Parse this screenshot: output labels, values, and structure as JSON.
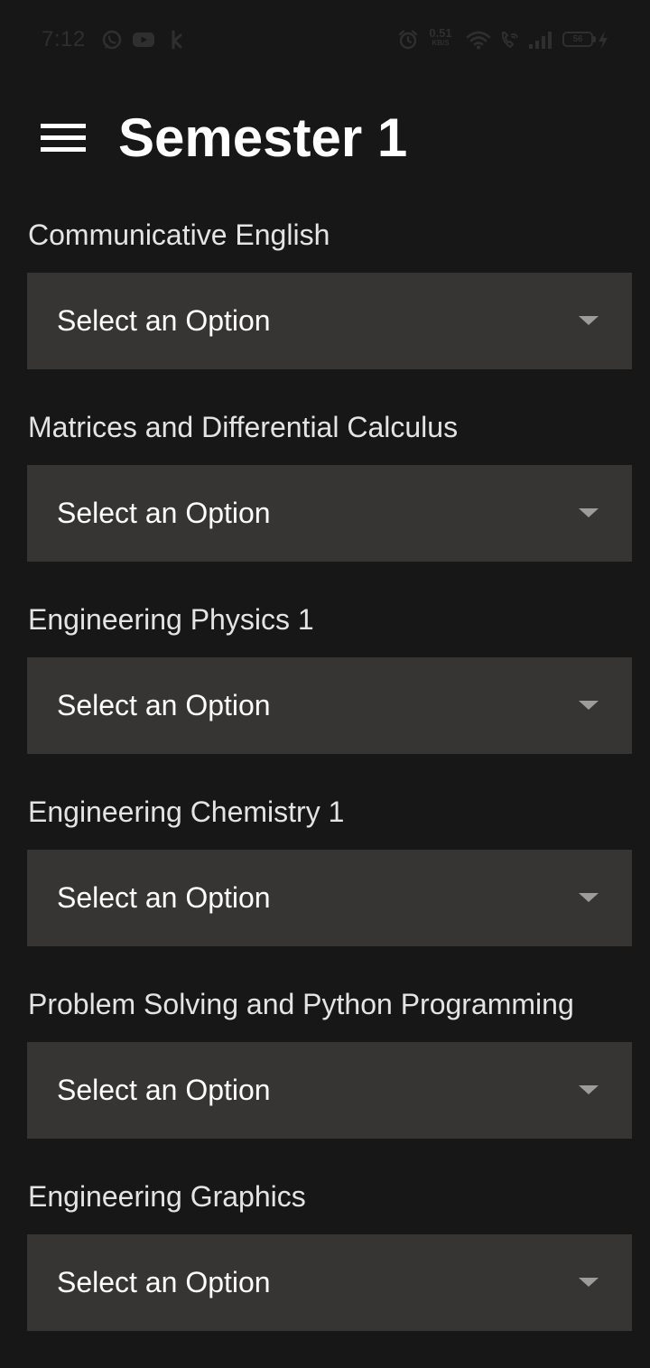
{
  "status_bar": {
    "time": "7:12",
    "net_speed_value": "0.51",
    "net_speed_unit": "KB/S",
    "battery_level": "56",
    "icons": [
      "whatsapp-icon",
      "youtube-icon",
      "app-notification-icon",
      "alarm-icon",
      "wifi-icon",
      "wifi-calling-icon",
      "signal-icon",
      "battery-icon",
      "charging-icon"
    ]
  },
  "header": {
    "title": "Semester 1",
    "menu_icon": "hamburger-menu-icon"
  },
  "subjects": [
    {
      "label": "Communicative English",
      "selected": "Select an Option"
    },
    {
      "label": "Matrices and Differential Calculus",
      "selected": "Select an Option"
    },
    {
      "label": "Engineering Physics 1",
      "selected": "Select an Option"
    },
    {
      "label": "Engineering Chemistry 1",
      "selected": "Select an Option"
    },
    {
      "label": "Problem Solving and Python Programming",
      "selected": "Select an Option"
    },
    {
      "label": "Engineering Graphics",
      "selected": "Select an Option"
    }
  ],
  "colors": {
    "background": "#171717",
    "dropdown_background": "#373434",
    "title_text": "#ffffff",
    "label_text": "#e4e4e4",
    "caret": "#9c9c9c"
  }
}
